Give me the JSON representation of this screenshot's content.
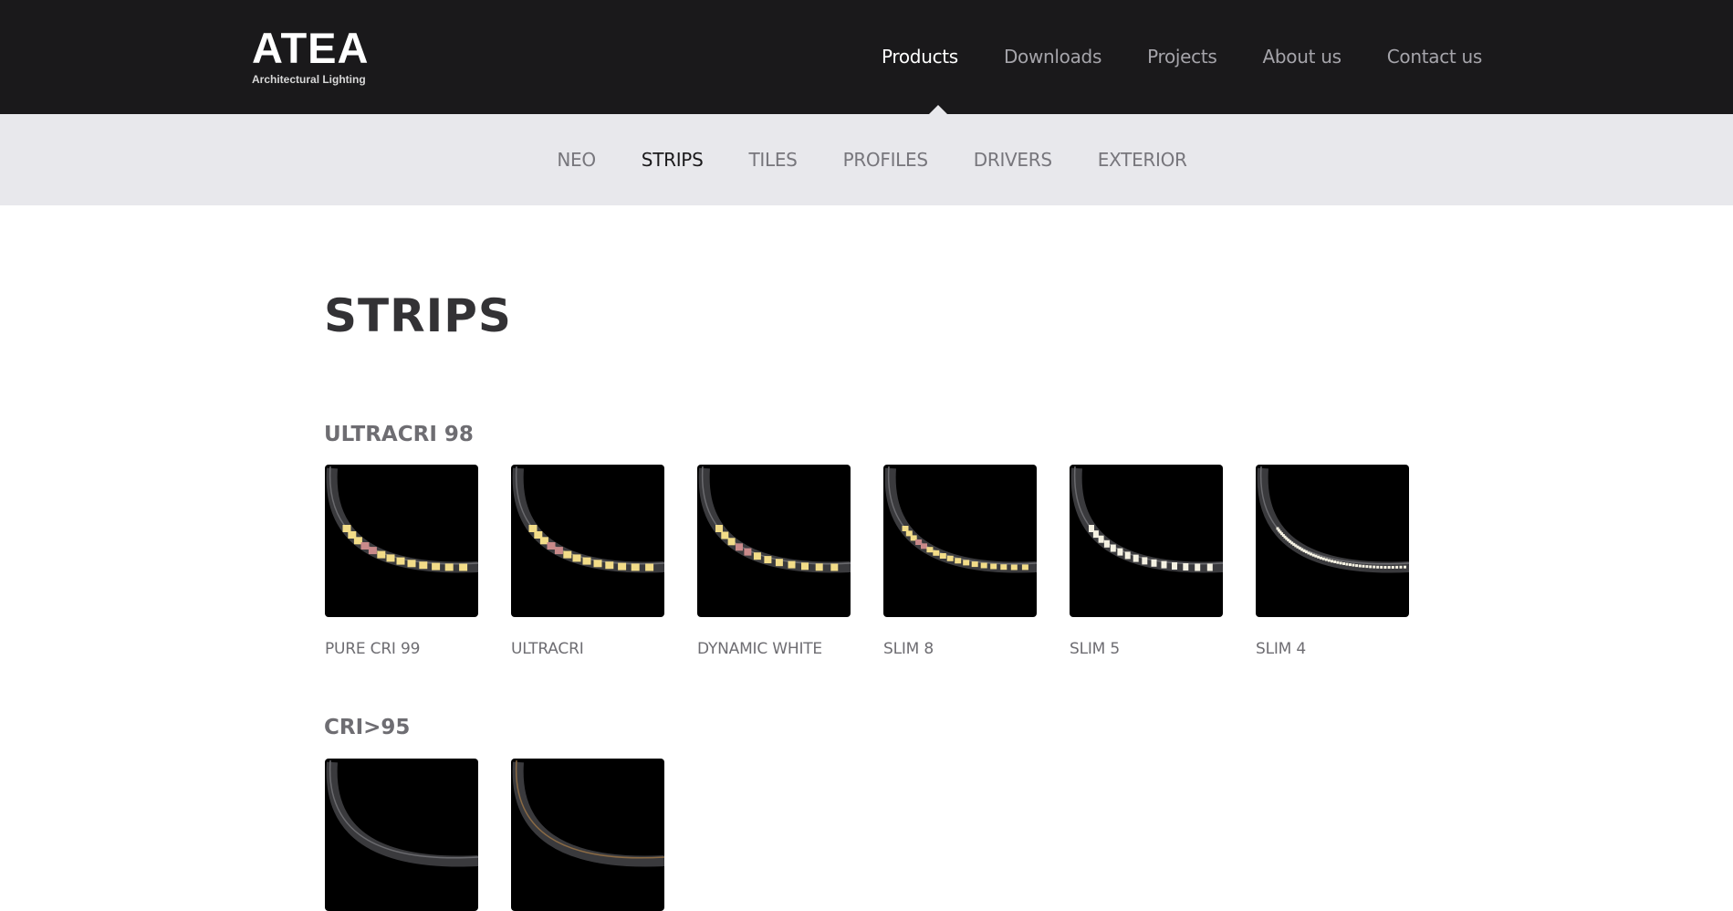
{
  "brand": {
    "name": "ATEA",
    "tagline": "Architectural Lighting"
  },
  "main_nav": [
    {
      "label": "Products",
      "active": true
    },
    {
      "label": "Downloads",
      "active": false
    },
    {
      "label": "Projects",
      "active": false
    },
    {
      "label": "About us",
      "active": false
    },
    {
      "label": "Contact us",
      "active": false
    }
  ],
  "sub_nav": [
    {
      "label": "NEO",
      "active": false
    },
    {
      "label": "STRIPS",
      "active": true
    },
    {
      "label": "TILES",
      "active": false
    },
    {
      "label": "PROFILES",
      "active": false
    },
    {
      "label": "DRIVERS",
      "active": false
    },
    {
      "label": "EXTERIOR",
      "active": false
    }
  ],
  "page": {
    "title": "STRIPS"
  },
  "sections": [
    {
      "title": "ULTRACRI 98",
      "products": [
        {
          "name": "PURE CRI 99",
          "image": "led-strip-image"
        },
        {
          "name": "ULTRACRI",
          "image": "led-strip-image"
        },
        {
          "name": "DYNAMIC WHITE",
          "image": "led-strip-image"
        },
        {
          "name": "SLIM 8",
          "image": "led-strip-image"
        },
        {
          "name": "SLIM 5",
          "image": "led-strip-image"
        },
        {
          "name": "SLIM 4",
          "image": "led-strip-image"
        }
      ]
    },
    {
      "title": "CRI>95",
      "products": [
        {
          "image": "led-strip-image"
        },
        {
          "image": "led-strip-image"
        }
      ]
    }
  ],
  "colors": {
    "header_bg": "#1a191b",
    "subnav_bg": "#e8e8ec",
    "led_warm": "#f2dc88",
    "led_cool": "#f4f1e2"
  }
}
